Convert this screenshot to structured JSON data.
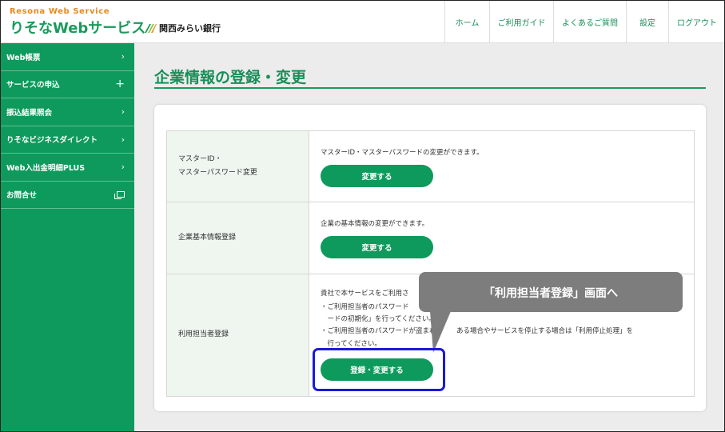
{
  "header": {
    "brand_sub": "Resona Web Service",
    "brand_main": "りそなWebサービス",
    "partner": "関西みらい銀行",
    "nav": [
      "ホーム",
      "ご利用ガイド",
      "よくあるご質問",
      "設定",
      "ログアウト"
    ]
  },
  "sidebar": {
    "items": [
      {
        "label": "Web帳票",
        "icon": "chevron-right-icon",
        "glyph": "›"
      },
      {
        "label": "サービスの申込",
        "icon": "plus-icon",
        "glyph": "+"
      },
      {
        "label": "振込結果照会",
        "icon": "chevron-right-icon",
        "glyph": "›"
      },
      {
        "label": "りそなビジネスダイレクト",
        "icon": "chevron-right-icon",
        "glyph": "›"
      },
      {
        "label": "Web入出金明細PLUS",
        "icon": "chevron-right-icon",
        "glyph": "›"
      },
      {
        "label": "お問合せ",
        "icon": "external-window-icon",
        "glyph": ""
      }
    ]
  },
  "main": {
    "title": "企業情報の登録・変更",
    "rows": [
      {
        "label_lines": [
          "マスターID・",
          "マスターパスワード変更"
        ],
        "description": "マスターID・マスターパスワードの変更ができます。",
        "button": "変更する"
      },
      {
        "label_lines": [
          "企業基本情報登録"
        ],
        "description": "企業の基本情報の変更ができます。",
        "button": "変更する"
      },
      {
        "label_lines": [
          "利用担当者登録"
        ],
        "description": "貴社で本サービスをご利用さ",
        "bullets": [
          "・ご利用担当者のパスワード",
          "　ードの初期化」を行ってください。",
          "・ご利用担当者のパスワードが盗まれ　　　ある場合やサービスを停止する場合は「利用停止処理」を",
          "　行ってください。"
        ],
        "button": "登録・変更する"
      }
    ]
  },
  "annotation": {
    "callout": "「利用担当者登録」画面へ",
    "callout_color": "#7d7d7d",
    "highlight_color": "#1a1ad8"
  },
  "colors": {
    "brand_green": "#0e9a5c",
    "brand_orange": "#e8891c"
  }
}
